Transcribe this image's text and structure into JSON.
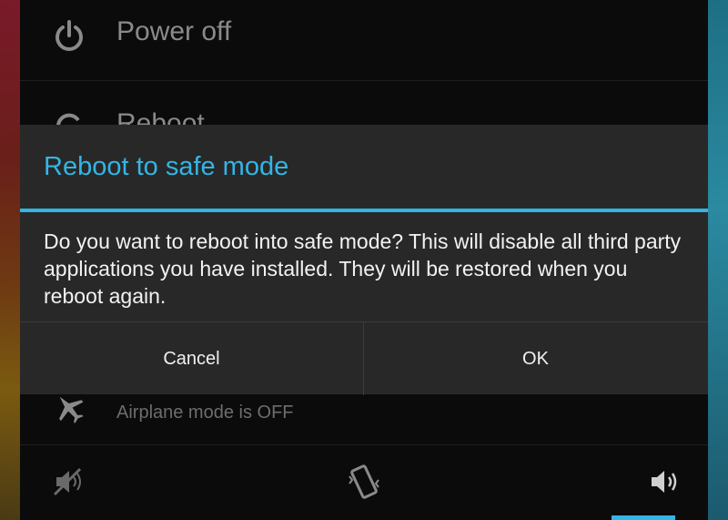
{
  "menu": {
    "power_off_label": "Power off",
    "reboot_label": "Reboot",
    "airplane_status": "Airplane mode is OFF"
  },
  "dialog": {
    "title": "Reboot to safe mode",
    "message": "Do you want to reboot into safe mode? This will disable all third party applications you have installed. They will be restored when you reboot again.",
    "cancel_label": "Cancel",
    "ok_label": "OK"
  },
  "icons": {
    "power": "power-icon",
    "reboot": "reboot-icon",
    "airplane": "airplane-icon",
    "silent": "sound-off-icon",
    "vibrate": "vibrate-icon",
    "sound_on": "sound-on-icon"
  },
  "colors": {
    "accent": "#33b5e5",
    "dialog_background": "#282828",
    "menu_background": "#0b0b0b"
  }
}
